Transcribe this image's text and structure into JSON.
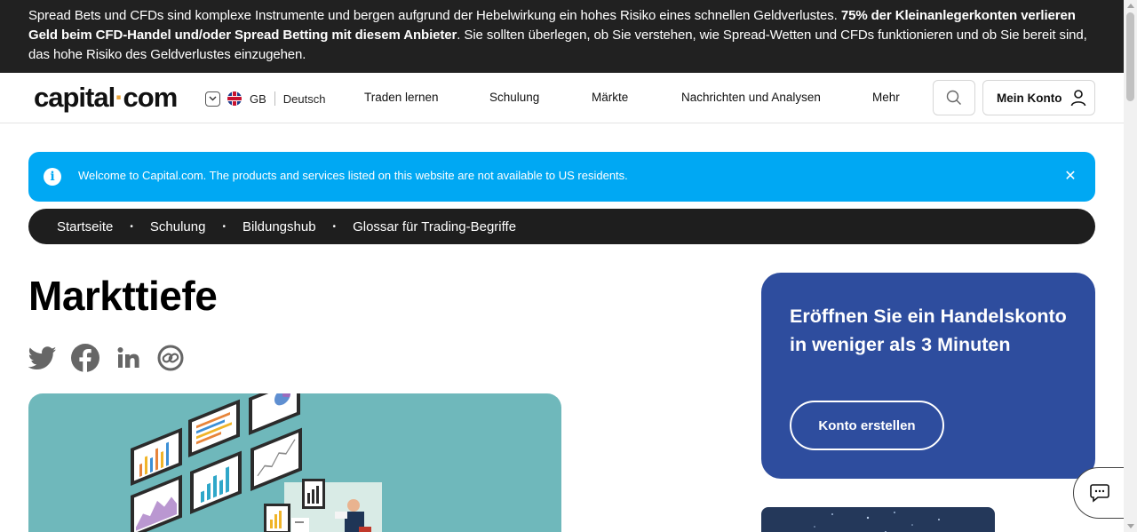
{
  "risk_warning": {
    "part1": "Spread Bets und CFDs sind komplexe Instrumente und bergen aufgrund der Hebelwirkung ein hohes Risiko eines schnellen Geldverlustes. ",
    "bold": "75% der Kleinanlegerkonten verlieren Geld beim CFD-Handel und/oder Spread Betting mit diesem Anbieter",
    "part2": ". Sie sollten überlegen, ob Sie verstehen, wie Spread-Wetten und CFDs funktionieren und ob Sie bereit sind, das hohe Risiko des Geldverlustes einzugehen."
  },
  "header": {
    "logo_left": "capital",
    "logo_dot": "·",
    "logo_right": "com",
    "region_code": "GB",
    "language": "Deutsch",
    "nav": [
      "Traden lernen",
      "Schulung",
      "Märkte",
      "Nachrichten und Analysen",
      "Mehr"
    ],
    "account_label": "Mein Konto"
  },
  "notice": {
    "icon_text": "i",
    "text": "Welcome to Capital.com. The products and services listed on this website are not available to US residents.",
    "close": "✕"
  },
  "breadcrumb": [
    "Startseite",
    "Schulung",
    "Bildungshub",
    "Glossar für Trading-Begriffe"
  ],
  "breadcrumb_separator": "•",
  "page": {
    "title": "Markttiefe"
  },
  "share_icons": [
    "twitter-icon",
    "facebook-icon",
    "linkedin-icon",
    "link-icon"
  ],
  "cta": {
    "heading": "Eröffnen Sie ein Handelskonto in weniger als 3 Minuten",
    "button": "Konto erstellen"
  },
  "colors": {
    "risk_bar": "#212121",
    "notice": "#00a8f3",
    "cta": "#2e4d9e",
    "hero": "#6fb8bb",
    "logo_dot": "#e8a33b"
  }
}
